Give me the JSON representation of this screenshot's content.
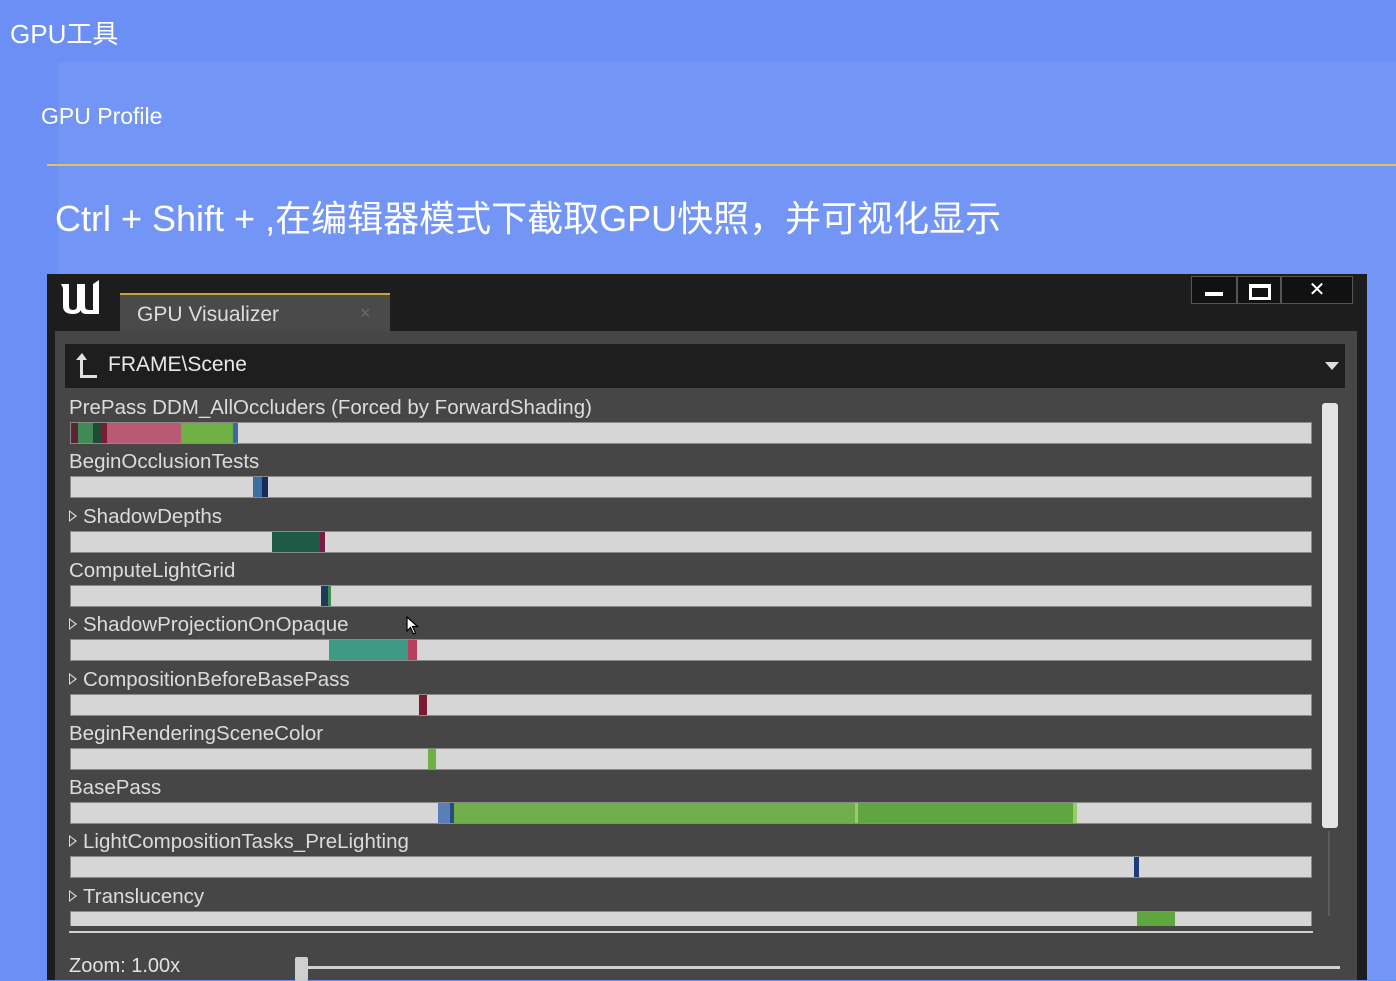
{
  "slide": {
    "top_title": "GPU工具",
    "sub_title": "GPU Profile",
    "headline": "Ctrl + Shift + ,在编辑器模式下截取GPU快照，并可视化显示"
  },
  "window": {
    "tab_label": "GPU Visualizer",
    "tab_close": "×",
    "close_glyph": "✕",
    "breadcrumb": "FRAME\\Scene",
    "zoom_label": "Zoom: 1.00x",
    "zoom_level": 0.0
  },
  "rows": [
    {
      "label": "PrePass DDM_AllOccluders (Forced by ForwardShading)",
      "expandable": false,
      "segments": [
        {
          "start": 0.0,
          "end": 0.006,
          "color": "#5a2332"
        },
        {
          "start": 0.006,
          "end": 0.018,
          "color": "#3f8a55"
        },
        {
          "start": 0.018,
          "end": 0.024,
          "color": "#1f4a37"
        },
        {
          "start": 0.024,
          "end": 0.029,
          "color": "#7a1b33"
        },
        {
          "start": 0.029,
          "end": 0.089,
          "color": "#b85a74"
        },
        {
          "start": 0.089,
          "end": 0.131,
          "color": "#6fb044"
        },
        {
          "start": 0.131,
          "end": 0.135,
          "color": "#3b6aa0"
        }
      ]
    },
    {
      "label": "BeginOcclusionTests",
      "expandable": false,
      "segments": [
        {
          "start": 0.147,
          "end": 0.154,
          "color": "#3a6fa3"
        },
        {
          "start": 0.154,
          "end": 0.159,
          "color": "#1b2a55"
        }
      ]
    },
    {
      "label": "ShadowDepths",
      "expandable": true,
      "segments": [
        {
          "start": 0.162,
          "end": 0.201,
          "color": "#1f5a45"
        },
        {
          "start": 0.201,
          "end": 0.205,
          "color": "#7a1b4a"
        }
      ]
    },
    {
      "label": "ComputeLightGrid",
      "expandable": false,
      "segments": [
        {
          "start": 0.202,
          "end": 0.207,
          "color": "#1c3a5a"
        },
        {
          "start": 0.207,
          "end": 0.209,
          "color": "#3f8a55"
        }
      ]
    },
    {
      "label": "ShadowProjectionOnOpaque",
      "expandable": true,
      "segments": [
        {
          "start": 0.208,
          "end": 0.272,
          "color": "#3e9a85"
        },
        {
          "start": 0.272,
          "end": 0.279,
          "color": "#b8405e"
        }
      ]
    },
    {
      "label": "CompositionBeforeBasePass",
      "expandable": true,
      "segments": [
        {
          "start": 0.281,
          "end": 0.287,
          "color": "#7a1b33"
        }
      ]
    },
    {
      "label": "BeginRenderingSceneColor",
      "expandable": false,
      "segments": [
        {
          "start": 0.288,
          "end": 0.294,
          "color": "#6fb044"
        }
      ]
    },
    {
      "label": "BasePass",
      "expandable": false,
      "segments": [
        {
          "start": 0.296,
          "end": 0.306,
          "color": "#5a7fb8"
        },
        {
          "start": 0.306,
          "end": 0.309,
          "color": "#2a4a80"
        },
        {
          "start": 0.309,
          "end": 0.632,
          "color": "#6fae4a"
        },
        {
          "start": 0.632,
          "end": 0.635,
          "color": "#9acb6a"
        },
        {
          "start": 0.635,
          "end": 0.808,
          "color": "#5fa63e"
        },
        {
          "start": 0.808,
          "end": 0.811,
          "color": "#9acb6a"
        }
      ]
    },
    {
      "label": "LightCompositionTasks_PreLighting",
      "expandable": true,
      "segments": [
        {
          "start": 0.857,
          "end": 0.861,
          "color": "#1b3a80"
        }
      ]
    },
    {
      "label": "Translucency",
      "expandable": true,
      "segments": [
        {
          "start": 0.86,
          "end": 0.89,
          "color": "#5fa63e"
        }
      ]
    }
  ],
  "colors": {
    "slide_background": "#6c8ff5",
    "accent_line": "#d9c56a",
    "tab_accent": "#c8a43a",
    "track": "#d6d6d6"
  },
  "icons": [
    "unreal-logo-icon",
    "up-arrow-icon",
    "dropdown-arrow-icon",
    "minimize-icon",
    "maximize-icon",
    "close-icon",
    "expand-triangle-icon",
    "mouse-cursor-icon"
  ]
}
